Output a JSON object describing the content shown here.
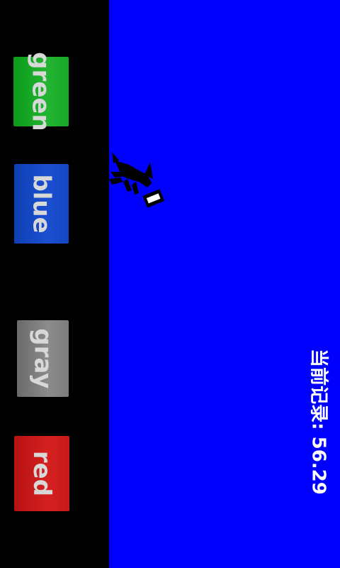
{
  "left_panel": {
    "buttons": [
      {
        "id": "green",
        "label": "green",
        "color": "#1aa828"
      },
      {
        "id": "blue",
        "label": "blue",
        "color": "#1548c4"
      },
      {
        "id": "gray",
        "label": "gray",
        "color": "#7d7d7d"
      },
      {
        "id": "red",
        "label": "red",
        "color": "#c81a1a"
      }
    ]
  },
  "play_field": {
    "background_color": "#0000ff",
    "character_icon": "stick-runner-icon"
  },
  "hud": {
    "record_text": "当前记录: 56.29"
  }
}
